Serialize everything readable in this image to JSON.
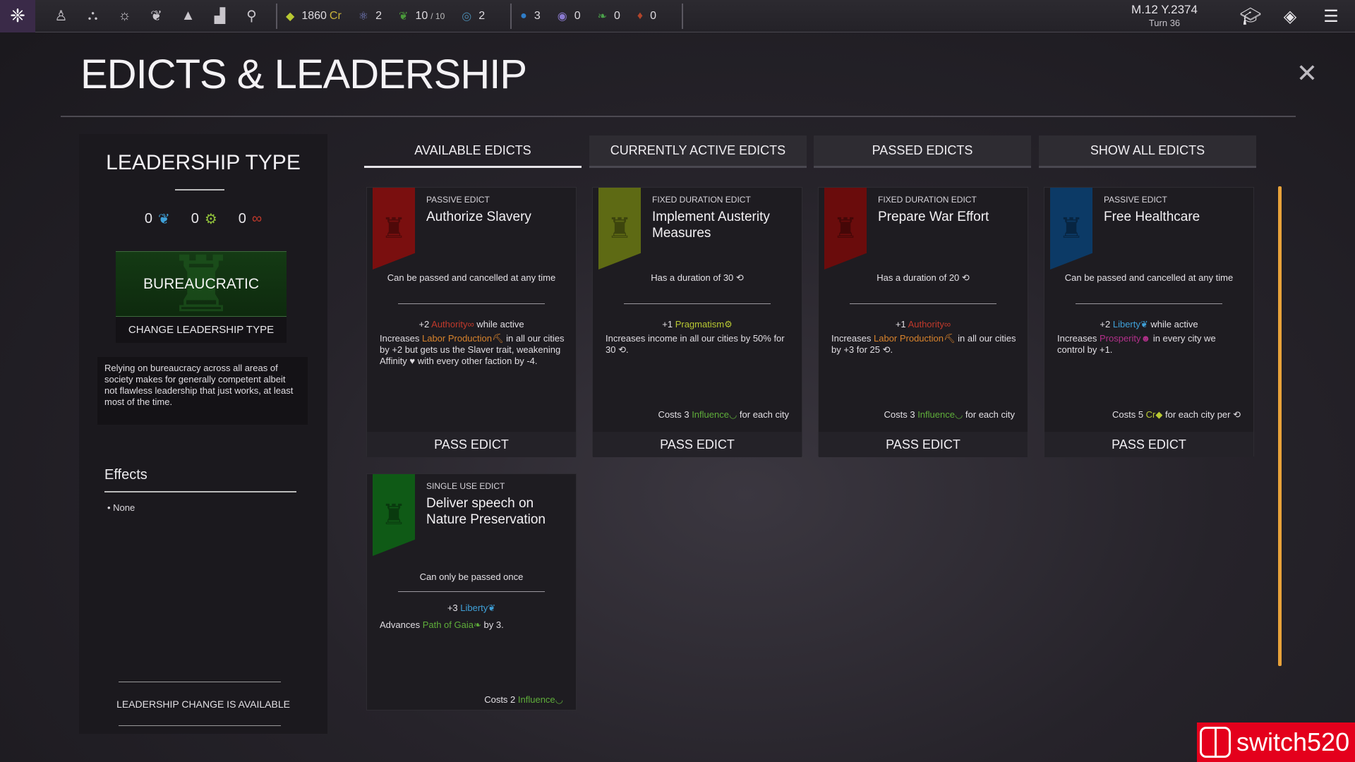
{
  "topbar": {
    "nav_icons": [
      "leader-icon",
      "cities-icon",
      "research-icon",
      "laurel-icon",
      "army-icon",
      "stats-icon",
      "search-icon"
    ],
    "resources": [
      {
        "icon": "credits-icon",
        "glyph": "◆",
        "color": "#b8c832",
        "value": "1860",
        "suffix": "Cr"
      },
      {
        "icon": "atom-icon",
        "glyph": "⚛",
        "color": "#7a83c9",
        "value": "2"
      },
      {
        "icon": "population-icon",
        "glyph": "❦",
        "color": "#4a9a3a",
        "value": "10",
        "small": "/ 10"
      },
      {
        "icon": "swirl-icon",
        "glyph": "◎",
        "color": "#4a8ab0",
        "value": "2"
      },
      {
        "icon": "water-drop-icon",
        "glyph": "●",
        "color": "#2f7dc8",
        "value": "3"
      },
      {
        "icon": "eye-icon",
        "glyph": "◉",
        "color": "#8a7ad0",
        "value": "0"
      },
      {
        "icon": "leaf-icon",
        "glyph": "❧",
        "color": "#4aa04a",
        "value": "0"
      },
      {
        "icon": "flame-icon",
        "glyph": "♦",
        "color": "#b0442a",
        "value": "0"
      }
    ],
    "date": "M.12 Y.2374",
    "turn": "Turn 36"
  },
  "title": "EDICTS & LEADERSHIP",
  "close_glyph": "✕",
  "leadership": {
    "title": "LEADERSHIP TYPE",
    "affinities": [
      {
        "value": "0",
        "glyph": "❦",
        "icon": "liberty-icon"
      },
      {
        "value": "0",
        "glyph": "⚙",
        "icon": "pragmatism-icon"
      },
      {
        "value": "0",
        "glyph": "∞",
        "icon": "authority-icon"
      }
    ],
    "type": "BUREAUCRATIC",
    "change_button": "CHANGE LEADERSHIP TYPE",
    "description": "Relying on bureaucracy across all areas of society makes for generally competent albeit not flawless leadership that just works, at least most of the time.",
    "effects_title": "Effects",
    "effects_item": "• None",
    "change_status": "LEADERSHIP CHANGE IS AVAILABLE"
  },
  "tabs": [
    "AVAILABLE EDICTS",
    "CURRENTLY ACTIVE EDICTS",
    "PASSED EDICTS",
    "SHOW ALL EDICTS"
  ],
  "pass_label": "PASS EDICT",
  "edicts": [
    {
      "type": "PASSIVE EDICT",
      "name": "Authorize Slavery",
      "banner_color": "#7a0f0f",
      "rule": "Can be passed and cancelled at any time",
      "bonus_pre": "+2 ",
      "bonus_key": "Authority",
      "bonus_glyph": "∞",
      "bonus_post": " while active",
      "desc_pre": "Increases ",
      "desc_key": "Labor Production",
      "desc_glyph": "⛏",
      "desc_post": " in all our cities by +2 but gets us the Slaver trait, weakening Affinity ♥ with every other faction by -4.",
      "cost_pre": "",
      "cost_key": "",
      "cost_glyph": "",
      "cost_post": ""
    },
    {
      "type": "FIXED DURATION EDICT",
      "name": "Implement Austerity Measures",
      "banner_color": "#5e6a14",
      "rule": "Has a duration of 30 ⟲",
      "bonus_pre": "+1 ",
      "bonus_key": "Pragmatism",
      "bonus_glyph": "⚙",
      "bonus_post": "",
      "desc_pre": "Increases income in all our cities by 50% for 30 ⟲.",
      "desc_key": "",
      "desc_glyph": "",
      "desc_post": "",
      "cost_pre": "Costs 3 ",
      "cost_key": "Influence",
      "cost_glyph": "◡",
      "cost_post": " for each city"
    },
    {
      "type": "FIXED DURATION EDICT",
      "name": "Prepare War Effort",
      "banner_color": "#6a0c0c",
      "rule": "Has a duration of 20 ⟲",
      "bonus_pre": "+1 ",
      "bonus_key": "Authority",
      "bonus_glyph": "∞",
      "bonus_post": "",
      "desc_pre": "Increases ",
      "desc_key": "Labor Production",
      "desc_glyph": "⛏",
      "desc_post": " in all our cities by +3 for 25 ⟲.",
      "cost_pre": "Costs 3 ",
      "cost_key": "Influence",
      "cost_glyph": "◡",
      "cost_post": " for each city"
    },
    {
      "type": "PASSIVE EDICT",
      "name": "Free Healthcare",
      "banner_color": "#0c3a66",
      "rule": "Can be passed and cancelled at any time",
      "bonus_pre": "+2 ",
      "bonus_key": "Liberty",
      "bonus_glyph": "❦",
      "bonus_post": " while active",
      "desc_pre": "Increases ",
      "desc_key": "Prosperity",
      "desc_glyph": "☻",
      "desc_post": " in every city we control by +1.",
      "cost_pre": "Costs 5 ",
      "cost_key": "Cr",
      "cost_glyph": "◆",
      "cost_post": " for each city per ⟲"
    },
    {
      "type": "SINGLE USE EDICT",
      "name": "Deliver speech on Nature Preservation",
      "banner_color": "#0f5a16",
      "rule": "Can only be passed once",
      "bonus_pre": "+3 ",
      "bonus_key": "Liberty",
      "bonus_glyph": "❦",
      "bonus_post": "",
      "desc_pre": "Advances ",
      "desc_key": "Path of Gaia",
      "desc_glyph": "❧",
      "desc_post": " by 3.",
      "cost_pre": "Costs 2 ",
      "cost_key": "Influence",
      "cost_glyph": "◡",
      "cost_post": ""
    }
  ],
  "watermark": "switch520"
}
